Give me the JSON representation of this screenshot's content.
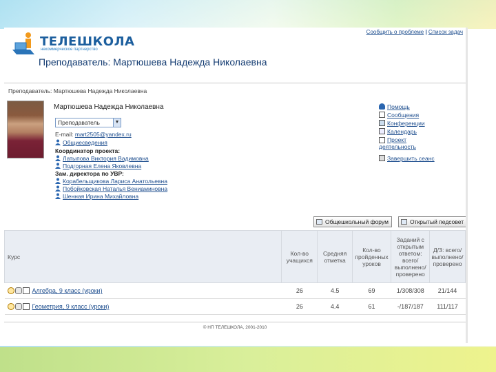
{
  "header": {
    "logo_text": "ТЕЛЕШКОЛА",
    "logo_subtitle": "некоммерческое партнерство",
    "links": [
      "Сообщить о проблеме",
      "Список задач"
    ],
    "links_separator": " | ",
    "page_title": "Преподаватель: Мартюшева Надежда Николаевна"
  },
  "breadcrumb": "Преподаватель: Мартюшева Надежда Николаевна",
  "profile": {
    "name": "Мартюшева Надежда Николаевна",
    "role_selected": "Преподаватель",
    "email_label": "E-mail:",
    "email": "mart2505@yandex.ru",
    "general_info": "Общиесведения",
    "coordinator_label": "Координатор проекта:",
    "coordinators": [
      "Латыпова Виктория Вадимовна",
      "Подгорная Елена Яковлевна"
    ],
    "deputy_label": "Зам. директора по УВР:",
    "deputies": [
      "Корабельщикова Лариса Анатольевна",
      "Побойковская Наталья Вениаминовна",
      "Шенная Ирина Михайловна"
    ]
  },
  "right_menu": [
    "Помощь",
    "Сообщения",
    "Конференции",
    "Календарь",
    "Проект деятельность",
    "Завершить сеанс"
  ],
  "buttons": {
    "forum": "Общешкольный форум",
    "staffroom": "Открытый педсовет"
  },
  "table": {
    "headers": [
      "Курс",
      "Кол-во учащихся",
      "Средняя отметка",
      "Кол-во пройденных уроков",
      "Заданий с открытым ответом: всего/выполнено/проверено",
      "Д/З: всего/выполнено/проверено"
    ],
    "rows": [
      {
        "course": "Алгебра, 9 класс (уроки)",
        "students": "26",
        "avg": "4.5",
        "lessons": "69",
        "open": "1/308/308",
        "hw": "21/144"
      },
      {
        "course": "Геометрия, 9 класс (уроки)",
        "students": "26",
        "avg": "4.4",
        "lessons": "61",
        "open": "-/187/187",
        "hw": "111/117"
      }
    ]
  },
  "footer": "© НП ТЕЛЕШКОЛА, 2001-2010",
  "colors": {
    "accent": "#1d5f9e",
    "link": "#1f4f8f",
    "table_header": "#e9edf3"
  }
}
